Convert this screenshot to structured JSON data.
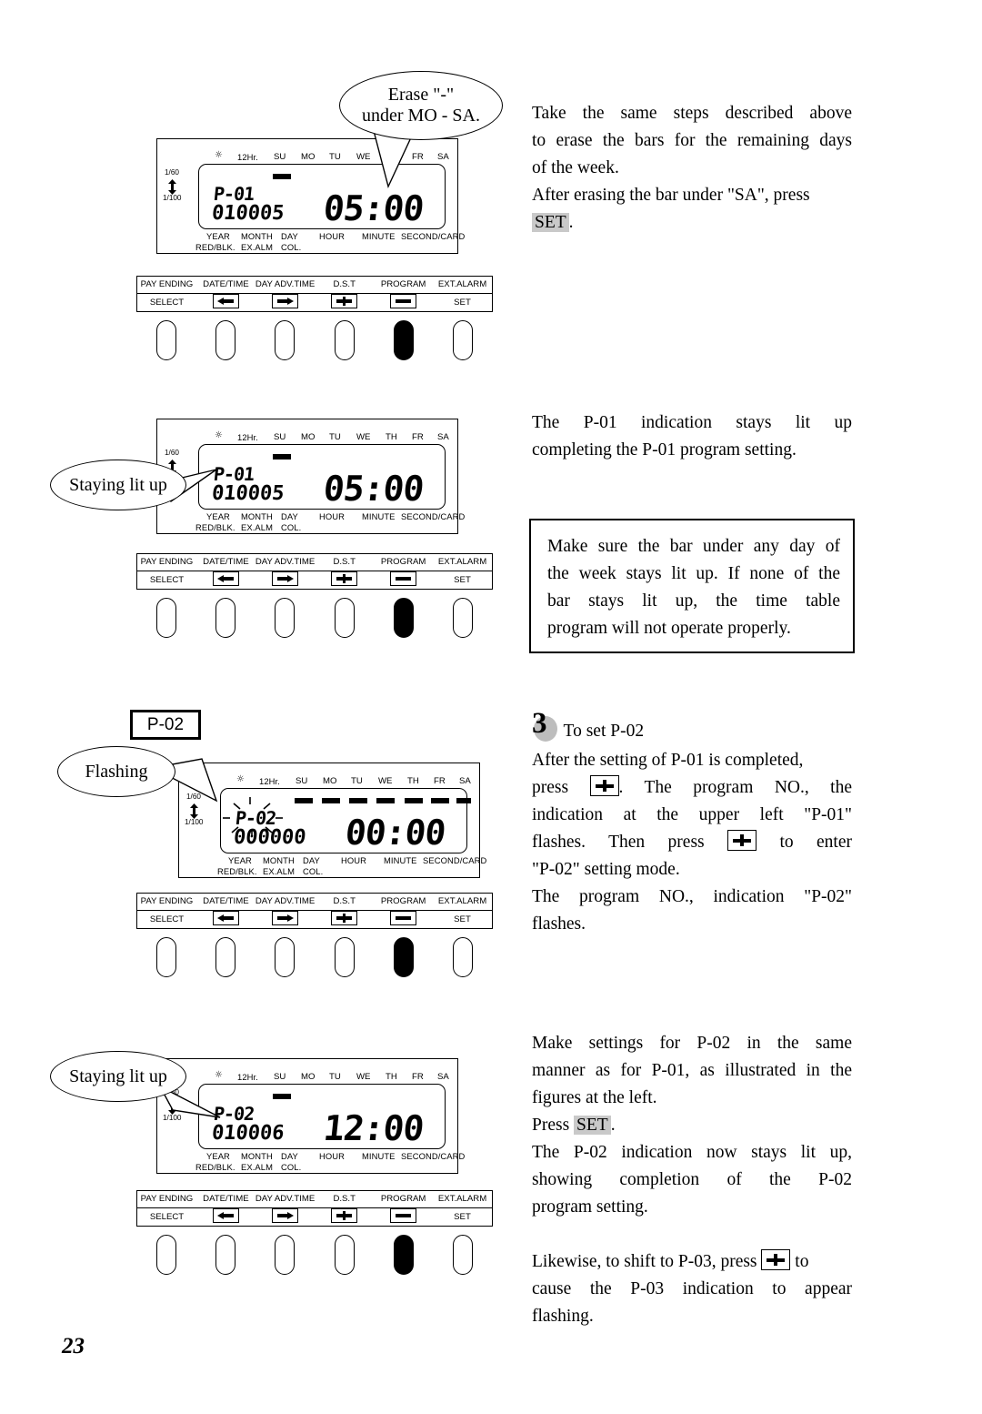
{
  "page": {
    "number": "23"
  },
  "callouts": {
    "erase": "Erase \"-\"\nunder MO - SA.",
    "erase_line1": "Erase \"-\"",
    "erase_line2": "under MO - SA.",
    "staying_lit_1": "Staying lit up",
    "flashing": "Flashing",
    "staying_lit_2": "Staying lit up",
    "p02_box": "P-02"
  },
  "lcd": {
    "common": {
      "sun_icon": "sun-icon",
      "hour_mode": "12Hr.",
      "days": [
        "SU",
        "MO",
        "TU",
        "WE",
        "TH",
        "FR",
        "SA"
      ],
      "scale_top": "1/60",
      "scale_bottom": "1/100",
      "footer_top": [
        "YEAR",
        "MONTH",
        "DAY",
        "HOUR",
        "MINUTE",
        "SECOND/CARD"
      ],
      "footer_bottom": [
        "RED/BLK.",
        "EX.ALM",
        "COL."
      ]
    },
    "panel1": {
      "program": "P-01",
      "date": "010005",
      "time": "05:00",
      "bars": [
        true,
        false,
        false,
        false,
        false,
        false,
        false
      ]
    },
    "panel2": {
      "program": "P-01",
      "date": "010005",
      "time": "05:00",
      "bars": [
        true,
        false,
        false,
        false,
        false,
        false,
        false
      ]
    },
    "panel3": {
      "program": "P-02",
      "date": "000000",
      "time": "00:00",
      "bars": [
        true,
        true,
        true,
        true,
        true,
        true,
        true
      ]
    },
    "panel4": {
      "program": "P-02",
      "date": "010006",
      "time": "12:00",
      "bars": [
        true,
        false,
        false,
        false,
        false,
        false,
        false
      ]
    }
  },
  "button_panel": {
    "top_row": [
      "PAY ENDING",
      "DATE/TIME",
      "DAY ADV.TIME",
      "D.S.T",
      "PROGRAM",
      "EXT.ALARM"
    ],
    "bottom_row": [
      "SELECT",
      "",
      "",
      "",
      "",
      "SET"
    ],
    "bottom_icons": [
      "",
      "left-arrow-icon",
      "right-arrow-icon",
      "plus-icon",
      "minus-icon",
      ""
    ],
    "keys_pressed": [
      false,
      false,
      false,
      false,
      true,
      false
    ]
  },
  "text": {
    "block1": {
      "lines": [
        "Take the same steps described above",
        "to erase the bars for the remaining days",
        "of the week.",
        "After erasing the bar under \"SA\", press"
      ],
      "set_key": "SET",
      "trailing": "."
    },
    "block2": {
      "lines": [
        "The P-01 indication stays lit up",
        "completing the P-01 program setting."
      ]
    },
    "notebox": {
      "lines": [
        "Make sure the bar under any day of",
        "the week stays lit up.  If none of the",
        "bar stays lit up, the time table",
        "program will not operate properly."
      ]
    },
    "block3": {
      "step": "3",
      "heading": "To set P-02",
      "l1": "After the setting of P-01 is completed,",
      "l2a": "press",
      "l2b": ". The program NO., the",
      "l3": "indication at the upper left \"P-01\"",
      "l4a": "flashes.  Then press",
      "l4b": "to enter",
      "l5": "\"P-02\" setting mode.",
      "l6": "The program NO., indication \"P-02\"",
      "l7": "flashes."
    },
    "block4": {
      "l1": "Make settings for P-02 in the same",
      "l2": "manner as for P-01, as illustrated in the",
      "l3": "figures at the left.",
      "l4a": "Press",
      "l4_key": "SET",
      "l4b": ".",
      "l5": "The P-02 indication now stays lit up,",
      "l6": "showing completion of the P-02",
      "l7": "program setting.",
      "l8a": "Likewise, to shift to P-03, press",
      "l8b": "to",
      "l9": "cause the P-03 indication to appear",
      "l10": "flashing."
    }
  }
}
